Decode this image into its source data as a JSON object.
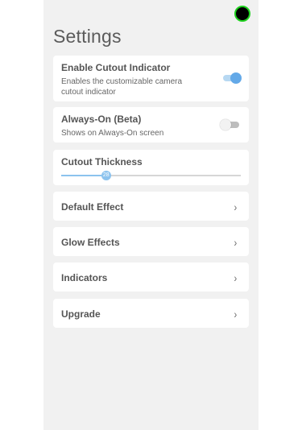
{
  "title": "Settings",
  "cutout_indicator": {
    "label": "Enable Cutout Indicator",
    "description": "Enables the customizable camera cutout indicator",
    "enabled": true
  },
  "always_on": {
    "label": "Always-On (Beta)",
    "description": "Shows on Always-On screen",
    "enabled": false
  },
  "cutout_thickness": {
    "label": "Cutout Thickness",
    "value": "28",
    "fraction": 0.25
  },
  "nav_items": [
    {
      "label": "Default Effect",
      "chevron": "›"
    },
    {
      "label": "Glow Effects",
      "chevron": "›"
    },
    {
      "label": "Indicators",
      "chevron": "›"
    },
    {
      "label": "Upgrade",
      "chevron": "›"
    }
  ],
  "colors": {
    "accent": "#63a9e8",
    "background": "#f1f1f1",
    "camera_ring": "#1fd11f"
  }
}
